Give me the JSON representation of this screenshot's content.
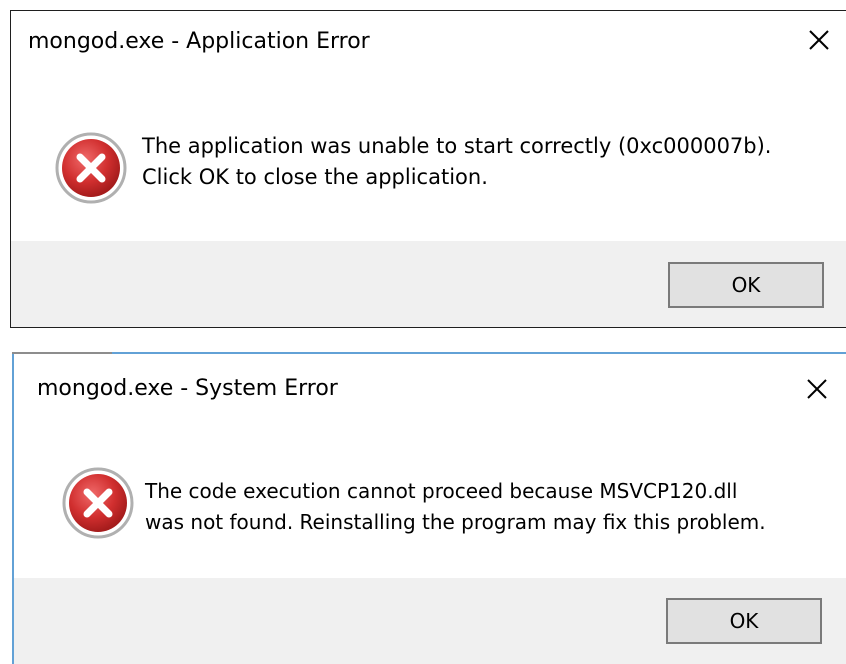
{
  "dialogs": [
    {
      "title": "mongod.exe - Application Error",
      "message_lines": [
        "The application was unable to start correctly (0xc000007b).",
        "Click OK to close the application."
      ],
      "ok_label": "OK",
      "icon": "error-icon"
    },
    {
      "title": "mongod.exe - System Error",
      "message_lines": [
        "The code execution cannot proceed because MSVCP120.dll",
        "was not found. Reinstalling the program may fix this problem."
      ],
      "ok_label": "OK",
      "icon": "error-icon"
    }
  ],
  "colors": {
    "error_red": "#d12f2f",
    "footer_bg": "#f0f0f0",
    "button_bg": "#e1e1e1",
    "active_border": "#62a1d6"
  }
}
